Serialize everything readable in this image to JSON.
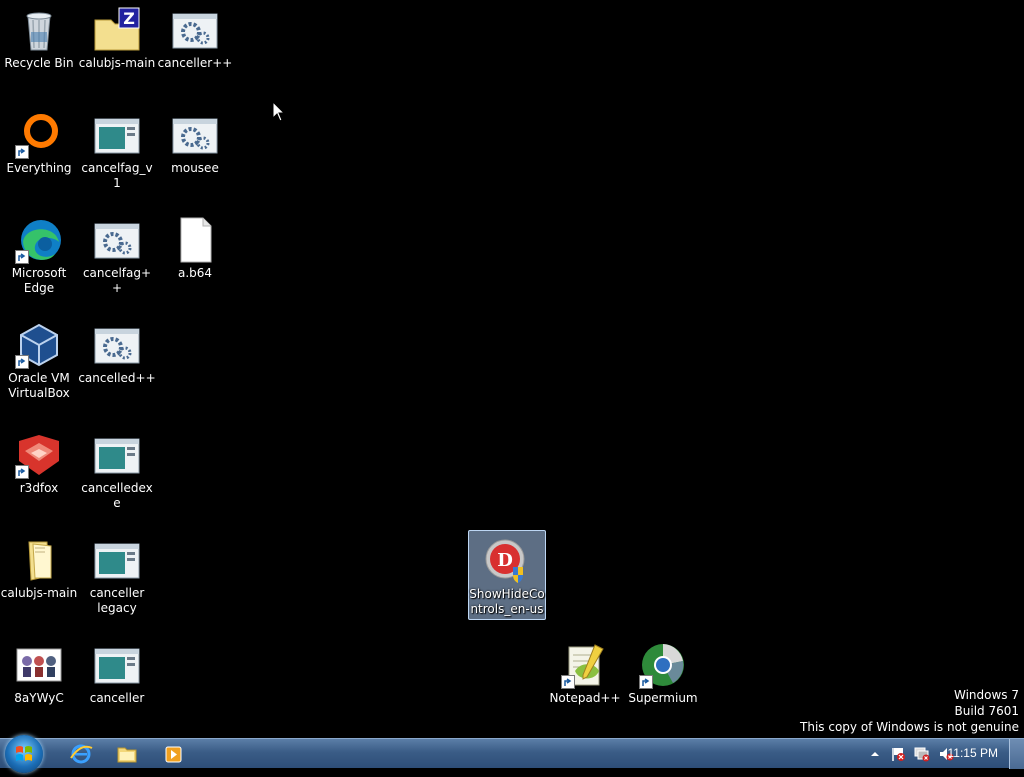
{
  "desktop_icons": {
    "recycle_bin": "Recycle Bin",
    "calubjs_zip": "calubjs-main",
    "canceller_pp": "canceller++",
    "everything": "Everything",
    "cancelfag_v1": "cancelfag_v1",
    "mousee": "mousee",
    "edge": "Microsoft Edge",
    "cancelfag_pp": "cancelfag++",
    "ab64": "a.b64",
    "virtualbox": "Oracle VM VirtualBox",
    "cancelled_pp": "cancelled++",
    "r3dfox": "r3dfox",
    "cancelledexe": "cancelledexe",
    "calubjs_folder": "calubjs-main",
    "canceller_legacy": "canceller legacy",
    "showhide": "ShowHideControls_en-us",
    "eightay": "8aYWyC",
    "canceller": "canceller",
    "notepadpp": "Notepad++",
    "supermium": "Supermium"
  },
  "watermark": {
    "line1": "Windows 7",
    "line2": "Build 7601",
    "line3": "This copy of Windows is not genuine"
  },
  "taskbar": {
    "clock": "11:15 PM",
    "pinned": [
      "internet-explorer-icon",
      "file-explorer-icon",
      "media-player-icon"
    ]
  },
  "colors": {
    "desktop_bg": "#000000",
    "taskbar": "#3a5c86",
    "selection": "#aac8f0"
  }
}
